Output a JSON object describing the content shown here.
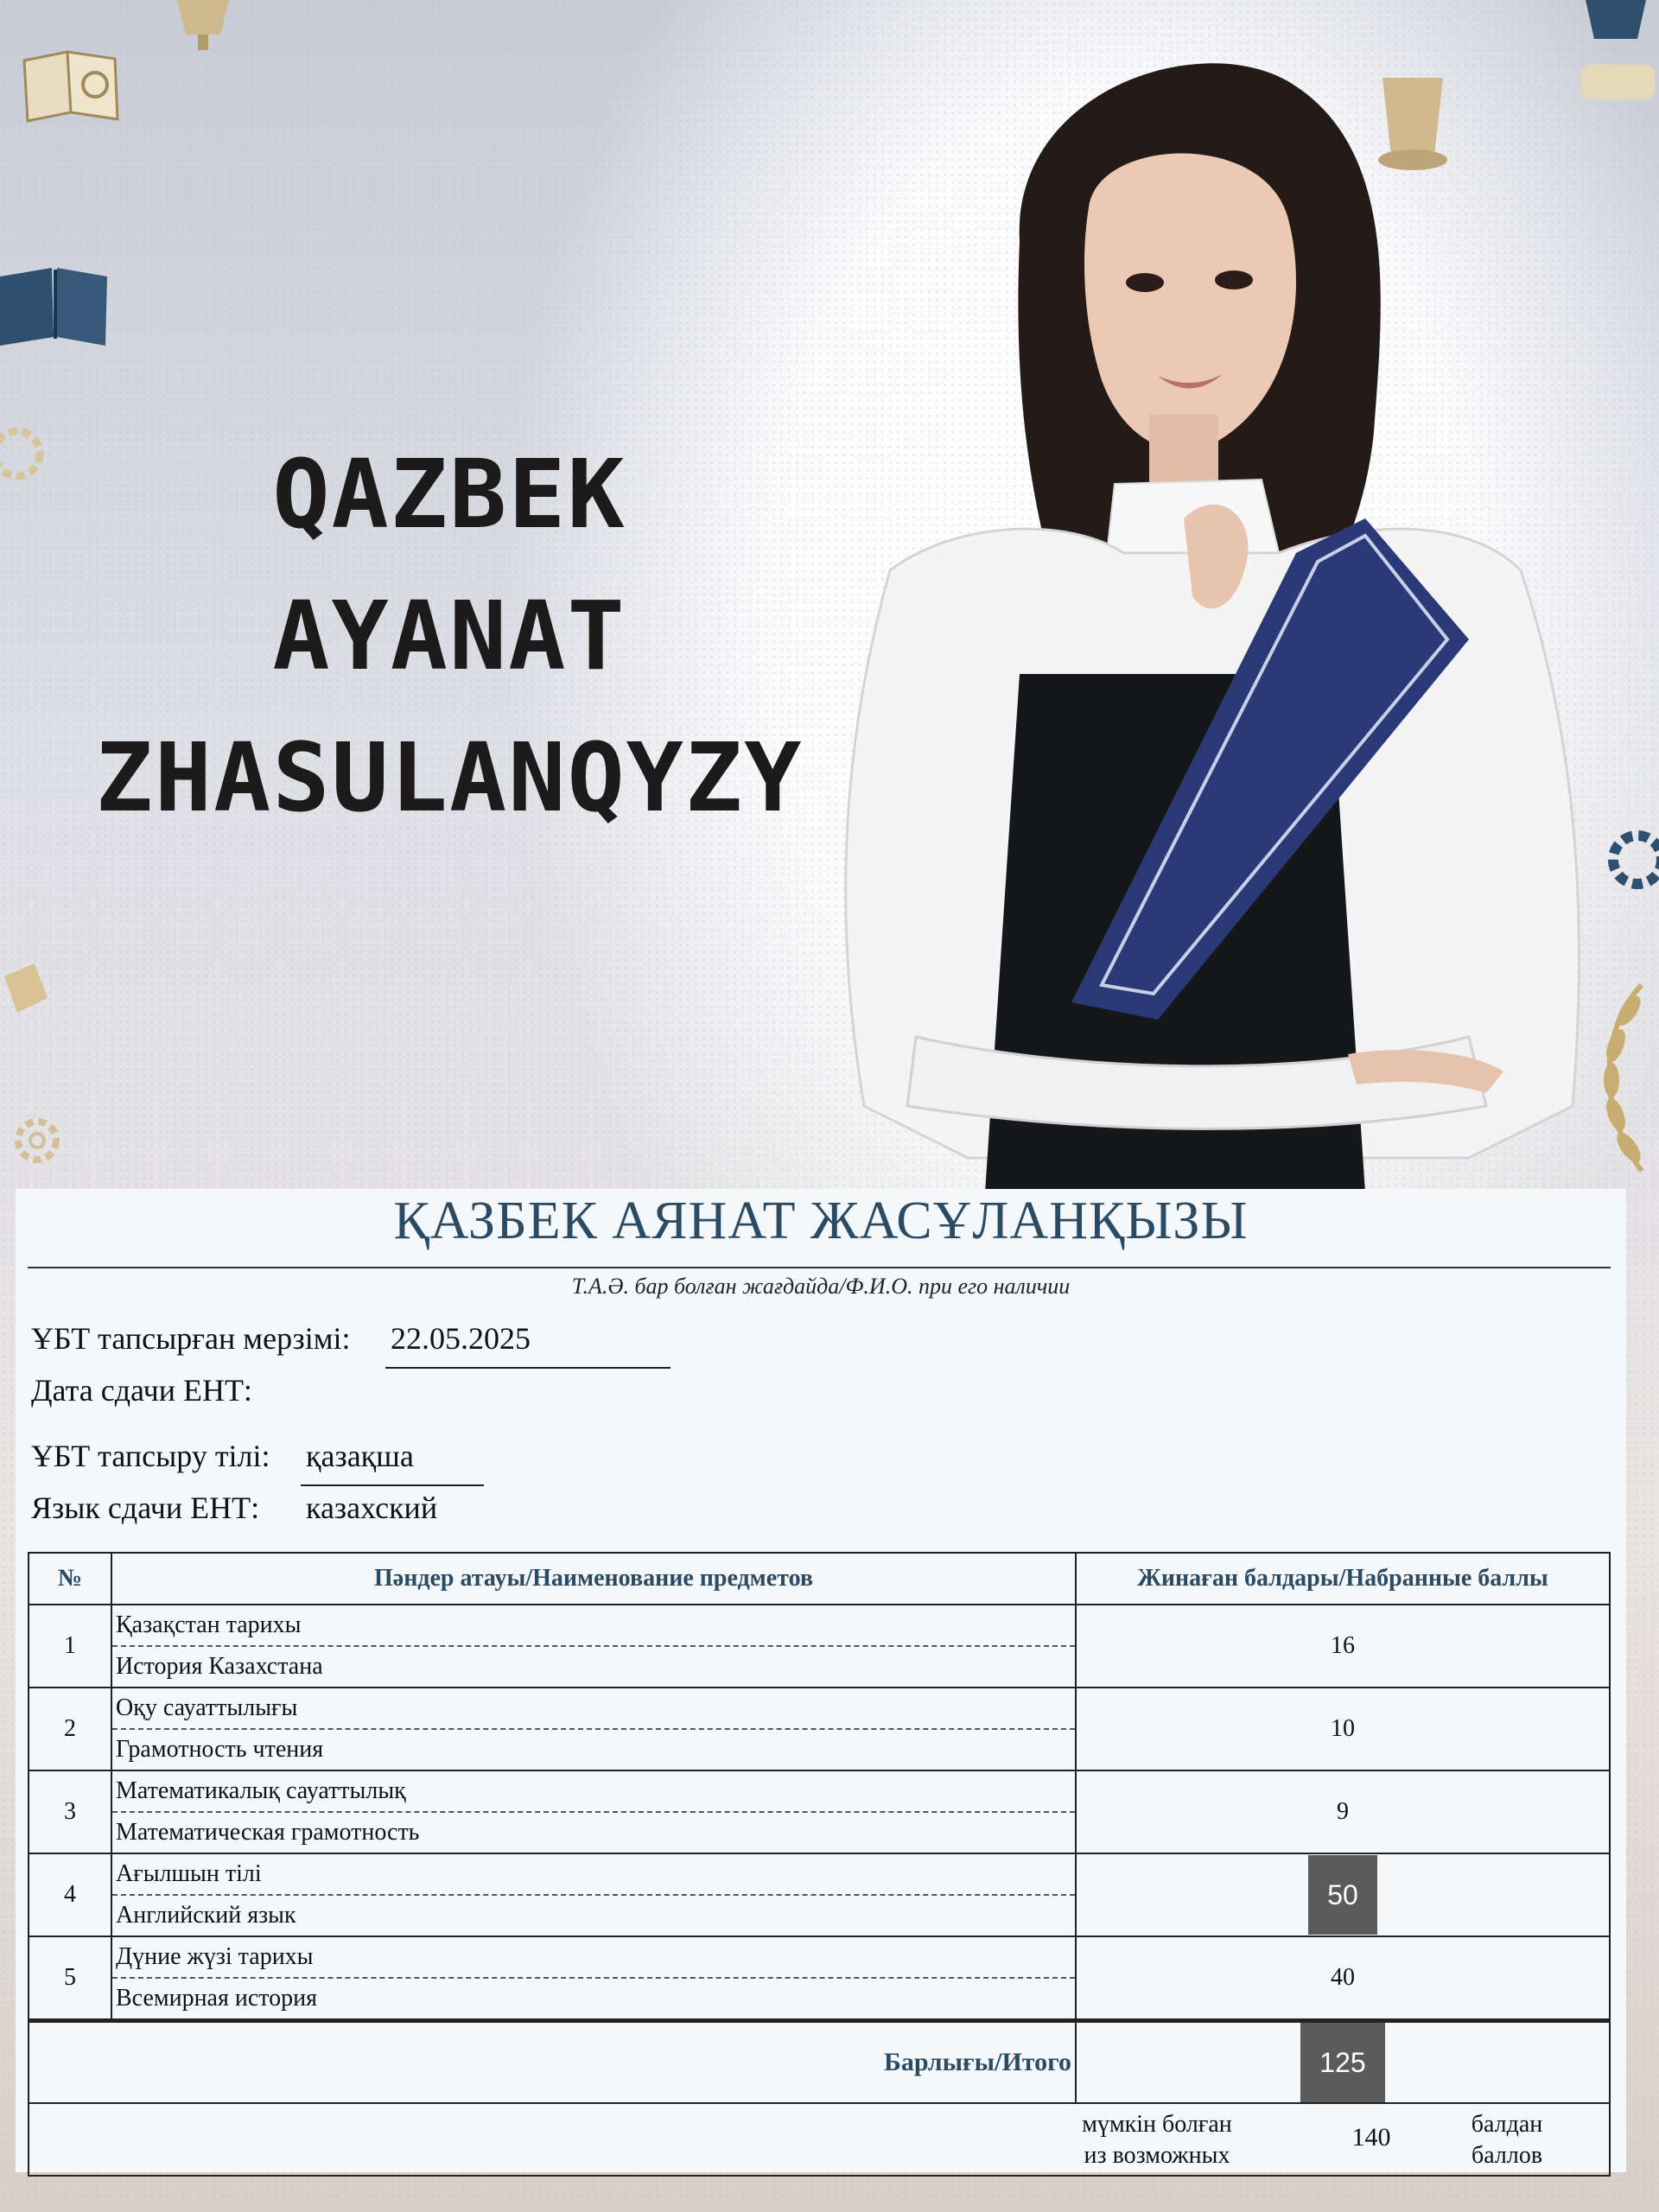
{
  "header": {
    "name_lines": [
      "QAZBEK",
      "AYANAT",
      "ZHASULANQYZY"
    ]
  },
  "certificate": {
    "full_name": "ҚАЗБЕК АЯНАТ ЖАСҰЛАНҚЫЗЫ",
    "name_caption": "Т.А.Ә. бар болған жағдайда/Ф.И.О. при его наличии",
    "date_label_kz": "ҰБТ тапсырған мерзімі:",
    "date_value": "22.05.2025",
    "date_label_ru": "Дата сдачи ЕНТ:",
    "lang_label_kz": "ҰБТ тапсыру тілі:",
    "lang_value_kz": "қазақша",
    "lang_label_ru": "Язык сдачи ЕНТ:",
    "lang_value_ru": "казахский",
    "table": {
      "col_no": "№",
      "col_subject": "Пәндер атауы/Наименование предметов",
      "col_score": "Жинаған балдары/Набранные баллы",
      "rows": [
        {
          "no": "1",
          "kz": "Қазақстан тарихы",
          "ru": "История Казахстана",
          "score": "16",
          "highlight": false
        },
        {
          "no": "2",
          "kz": "Оқу сауаттылығы",
          "ru": "Грамотность чтения",
          "score": "10",
          "highlight": false
        },
        {
          "no": "3",
          "kz": "Математикалық сауаттылық",
          "ru": "Математическая грамотность",
          "score": "9",
          "highlight": false
        },
        {
          "no": "4",
          "kz": "Ағылшын тілі",
          "ru": "Английский язык",
          "score": "50",
          "highlight": true
        },
        {
          "no": "5",
          "kz": "Дүние жүзі тарихы",
          "ru": "Всемирная история",
          "score": "40",
          "highlight": false
        }
      ],
      "total_label": "Барлығы/Итого",
      "total_value": "125",
      "possible_kz": "мүмкін болған",
      "possible_ru": "из возможных",
      "possible_value": "140",
      "points_kz": "балдан",
      "points_ru": "баллов"
    }
  }
}
